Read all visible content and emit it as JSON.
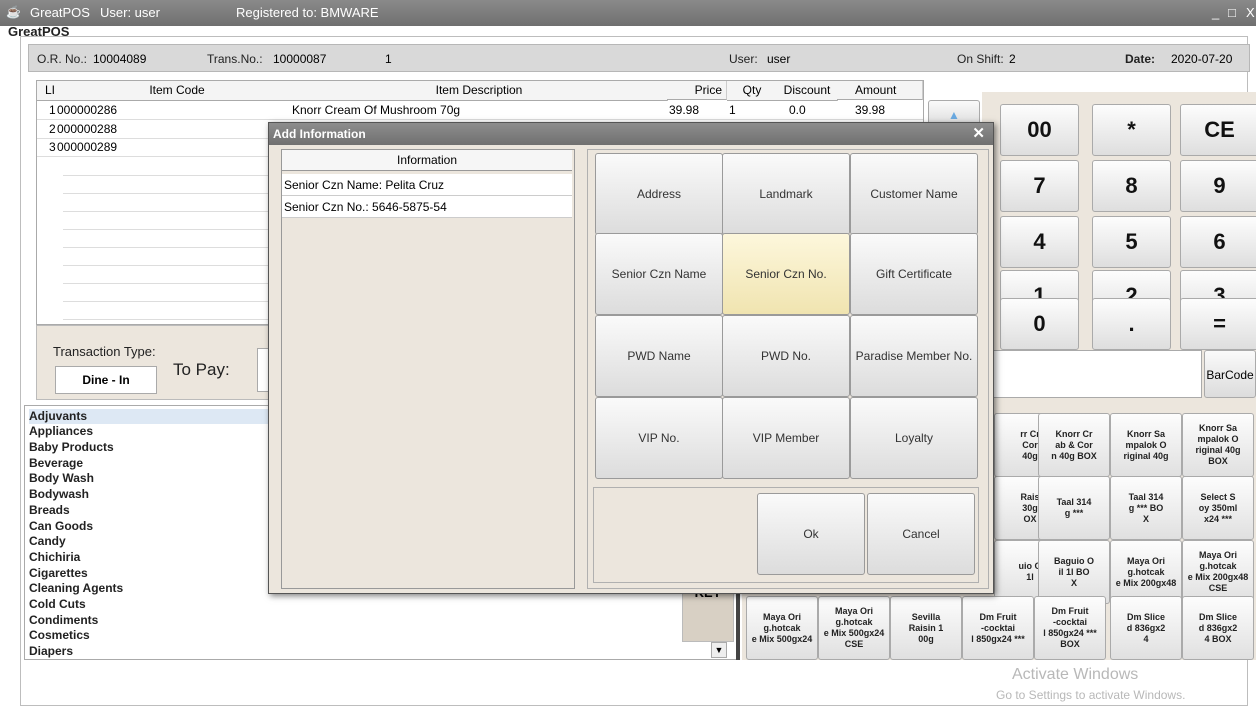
{
  "window": {
    "app_name": "GreatPOS",
    "user_label": "User: user",
    "registered": "Registered to: BMWARE",
    "app_label": "GreatPOS",
    "controls": [
      "_",
      "□",
      "X"
    ]
  },
  "header": {
    "or_label": "O.R. No.:",
    "or_value": "10004089",
    "trans_label": "Trans.No.:",
    "trans_value": "10000087",
    "count": "1",
    "user_label": "User:",
    "user_value": "user",
    "shift_label": "On Shift:",
    "shift_value": "2",
    "date_label": "Date:",
    "date_value": "2020-07-20"
  },
  "grid": {
    "columns": [
      "LI",
      "Item Code",
      "Item Description",
      "Price",
      "Qty",
      "Discount",
      "Amount"
    ],
    "rows": [
      {
        "li": "1",
        "code": "000000286",
        "desc": "Knorr Cream Of Mushroom 70g",
        "price": "39.98",
        "qty": "1",
        "discount": "0.0",
        "amount": "39.98"
      },
      {
        "li": "2",
        "code": "000000288",
        "desc": "",
        "price": "",
        "qty": "",
        "discount": "",
        "amount": ""
      },
      {
        "li": "3",
        "code": "000000289",
        "desc": "",
        "price": "",
        "qty": "",
        "discount": "",
        "amount": ""
      }
    ]
  },
  "transaction": {
    "type_label": "Transaction Type:",
    "type_value": "Dine - In",
    "to_pay_label": "To Pay:"
  },
  "categories": [
    "Adjuvants",
    "Appliances",
    "Baby Products",
    "Beverage",
    "Body Wash",
    "Bodywash",
    "Breads",
    "Can Goods",
    "Candy",
    "Chichiria",
    "Cigarettes",
    "Cleaning Agents",
    "Cold Cuts",
    "Condiments",
    "Cosmetics",
    "Diapers"
  ],
  "keypad": {
    "keys": [
      "00",
      "*",
      "CE",
      "7",
      "8",
      "9",
      "4",
      "5",
      "6",
      "1",
      "2",
      "3",
      "0",
      ".",
      "="
    ],
    "barcode_label": "BarCode",
    "key_label": "KEY"
  },
  "products": [
    "rr Cr\nCor\n40g",
    "Knorr Cr\nab & Cor\nn 40g BOX",
    "Knorr Sa\nmpalok O\nriginal 40g",
    "Knorr Sa\nmpalok O\nriginal 40g\nBOX",
    "Rais\n30g\nOX",
    "Taal 314\ng ***",
    "Taal 314\ng *** BO\nX",
    "Select S\noy 350ml\nx24 ***",
    "uio O\n1l",
    "Baguio O\nil 1l BO\nX",
    "Maya Ori\ng.hotcak\ne Mix 200gx48",
    "Maya Ori\ng.hotcak\ne Mix 200gx48\nCSE",
    "Maya Ori\ng.hotcak\ne Mix 500gx24",
    "Maya Ori\ng.hotcak\ne Mix 500gx24\nCSE",
    "Sevilla\nRaisin 1\n00g",
    "Dm Fruit\n-cocktai\nl 850gx24 ***",
    "Dm Fruit\n-cocktai\nl 850gx24 ***\nBOX",
    "Dm Slice\nd 836gx2\n4",
    "Dm Slice\nd 836gx2\n4 BOX"
  ],
  "dialog": {
    "title": "Add Information",
    "info_header": "Information",
    "info_rows": [
      "Senior Czn Name: Pelita Cruz",
      "Senior Czn No.: 5646-5875-54"
    ],
    "buttons": [
      "Address",
      "Landmark",
      "Customer Name",
      "Senior Czn Name",
      "Senior Czn No.",
      "Gift Certificate",
      "PWD Name",
      "PWD No.",
      "Paradise Member No.",
      "VIP No.",
      "VIP Member",
      "Loyalty"
    ],
    "ok_label": "Ok",
    "cancel_label": "Cancel"
  },
  "watermark": {
    "line1": "Activate Windows",
    "line2": "Go to Settings to activate Windows."
  }
}
